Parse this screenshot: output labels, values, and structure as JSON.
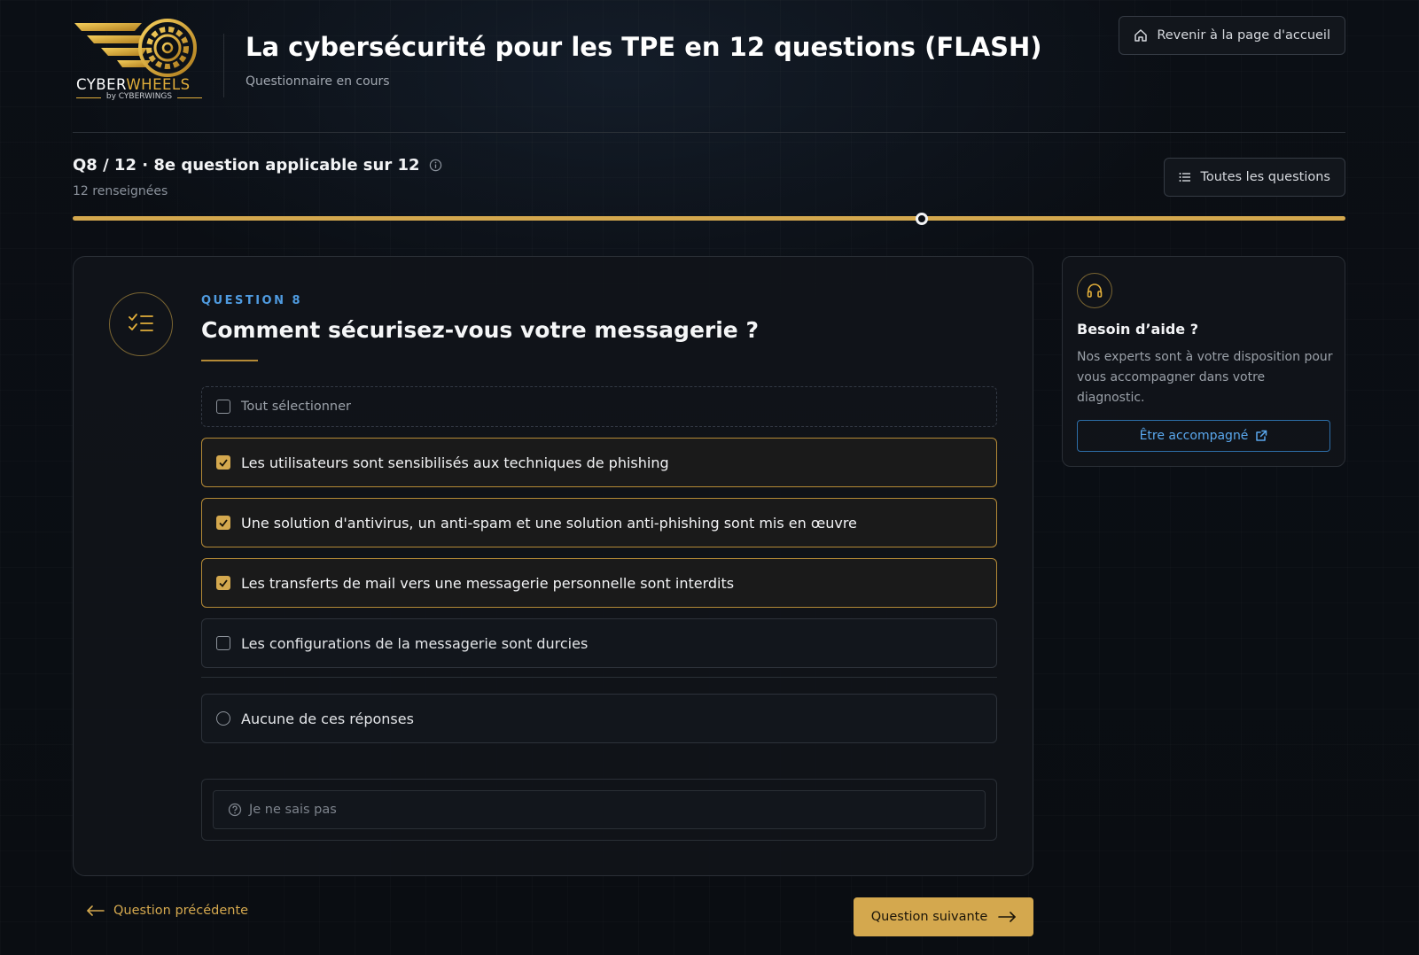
{
  "header": {
    "logo": {
      "brand_primary": "CYBER",
      "brand_secondary": "WHEELS",
      "byline": "by CYBERWINGS"
    },
    "title": "La cybersécurité pour les TPE en 12 questions (FLASH)",
    "subtitle": "Questionnaire en cours",
    "home_button_label": "Revenir à la page d'accueil",
    "home_icon": "home-icon"
  },
  "progress": {
    "title": "Q8 / 12 · 8e question applicable sur 12",
    "answered_label": "12 renseignées",
    "all_questions_label": "Toutes les questions",
    "current_fraction": 0.667,
    "accent_color": "#d4a84e"
  },
  "question": {
    "label": "QUESTION 8",
    "title": "Comment sécurisez-vous votre messagerie ?",
    "select_all_label": "Tout sélectionner",
    "options": [
      {
        "label": "Les utilisateurs sont sensibilisés aux techniques de phishing",
        "checked": true
      },
      {
        "label": "Une solution d'antivirus, un anti-spam et une solution anti-phishing sont mis en œuvre",
        "checked": true
      },
      {
        "label": "Les transferts de mail vers une messagerie personnelle sont interdits",
        "checked": true
      },
      {
        "label": "Les configurations de la messagerie sont durcies",
        "checked": false
      }
    ],
    "none_label": "Aucune de ces réponses",
    "dont_know_label": "Je ne sais pas"
  },
  "navigation": {
    "previous_label": "Question précédente",
    "next_label": "Question suivante"
  },
  "help": {
    "title": "Besoin d’aide ?",
    "text": "Nos experts sont à votre disposition pour vous accompagner dans votre diagnostic.",
    "button_label": "Être accompagné"
  }
}
